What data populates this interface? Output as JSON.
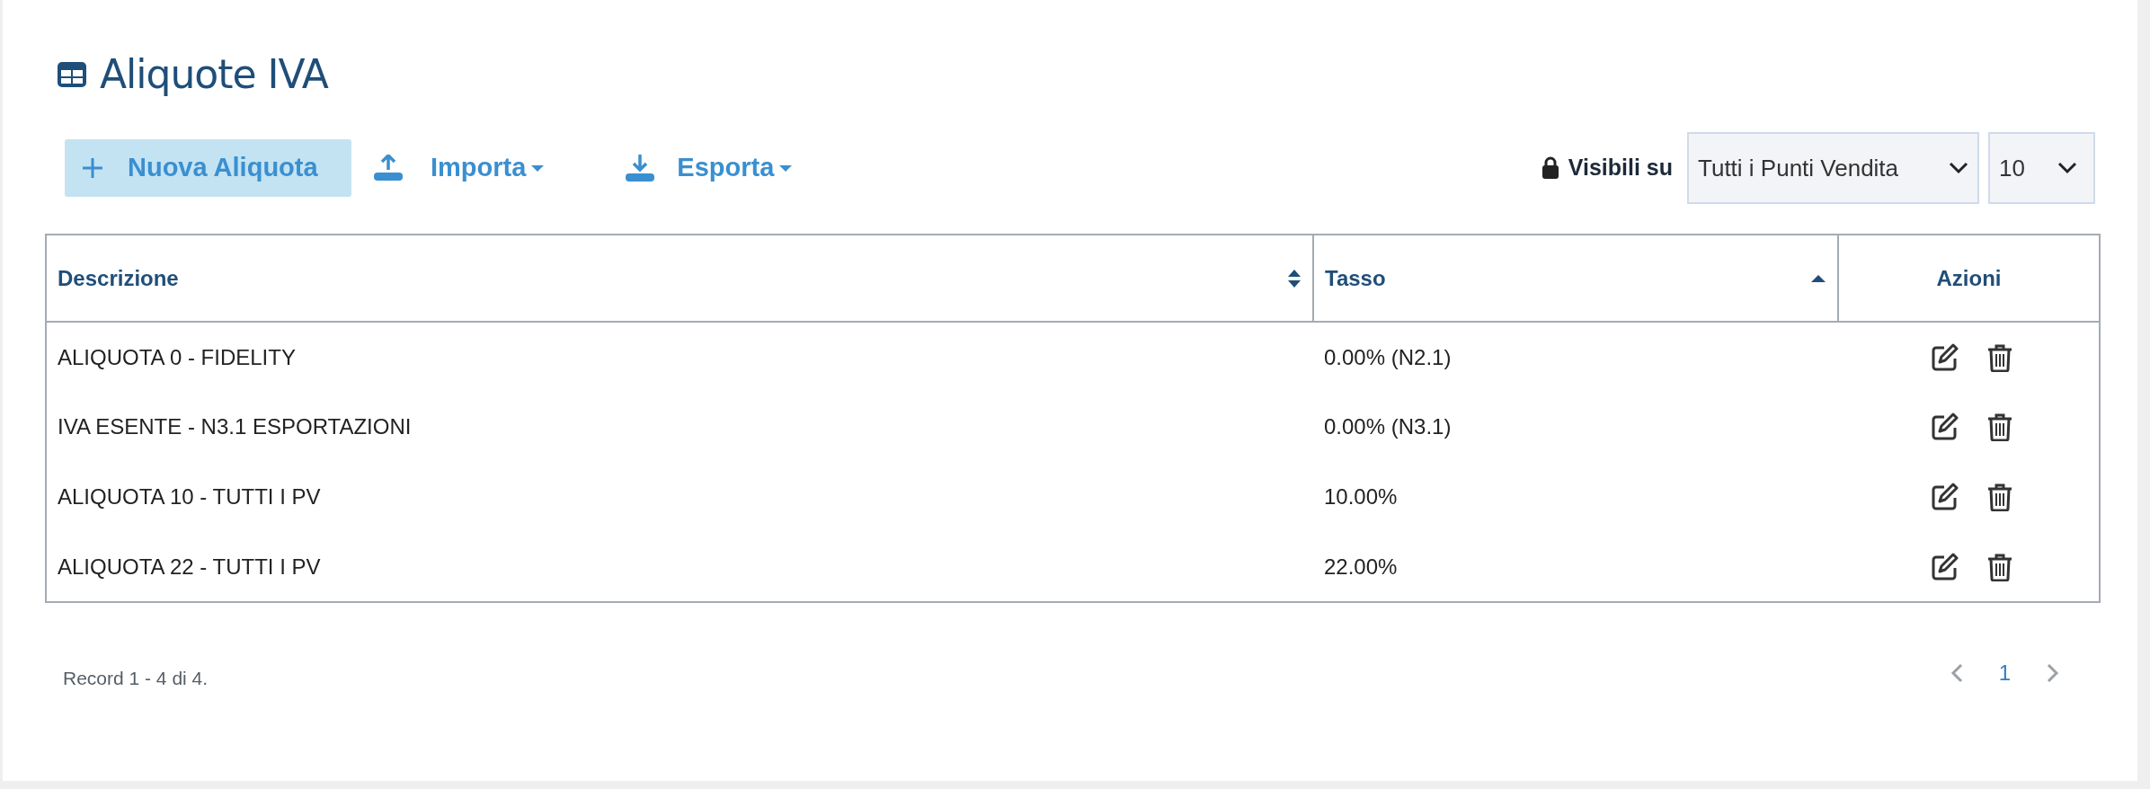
{
  "page": {
    "title": "Aliquote IVA"
  },
  "toolbar": {
    "new_button": "Nuova Aliquota",
    "import_menu": "Importa",
    "export_menu": "Esporta",
    "visibility_label": "Visibili su",
    "store_select": "Tutti i Punti Vendita",
    "page_size_select": "10"
  },
  "table": {
    "columns": [
      {
        "label": "Descrizione",
        "sortable": true,
        "sorted": false
      },
      {
        "label": "Tasso",
        "sortable": true,
        "sorted": true
      },
      {
        "label": "Azioni",
        "sortable": false
      }
    ],
    "rows": [
      {
        "description": "ALIQUOTA 0 - FIDELITY",
        "rate": "0.00% (N2.1)"
      },
      {
        "description": "IVA ESENTE - N3.1 ESPORTAZIONI",
        "rate": "0.00% (N3.1)"
      },
      {
        "description": "ALIQUOTA 10 - TUTTI I PV",
        "rate": "10.00%"
      },
      {
        "description": "ALIQUOTA 22 - TUTTI I PV",
        "rate": "22.00%"
      }
    ]
  },
  "footer": {
    "record_count": "Record 1 - 4 di 4.",
    "pages": [
      {
        "label": "1",
        "selected": true
      }
    ]
  }
}
